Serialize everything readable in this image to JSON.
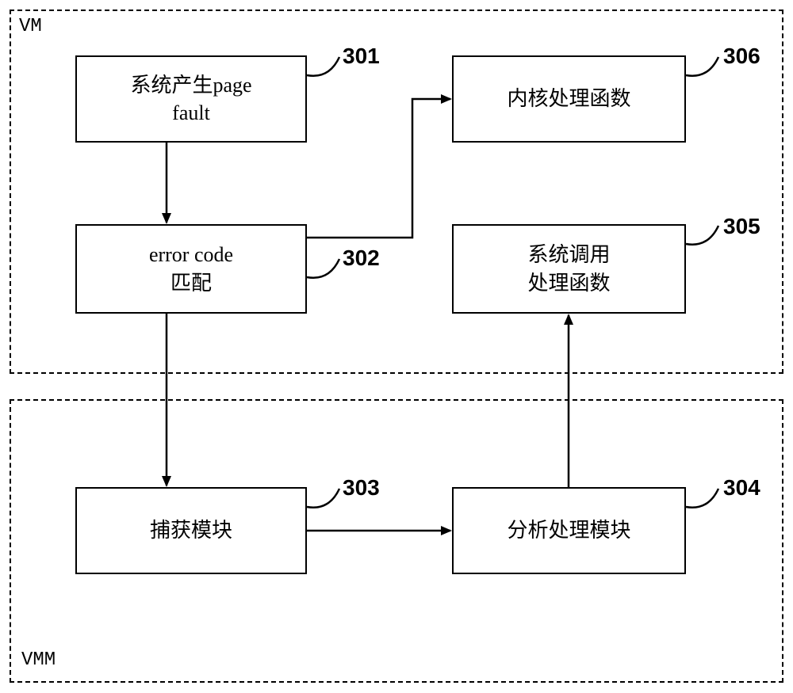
{
  "zones": {
    "vm": {
      "label": "VM"
    },
    "vmm": {
      "label": "VMM"
    }
  },
  "blocks": {
    "b301": {
      "text": "系统产生page\nfault",
      "num": "301"
    },
    "b302": {
      "text": "error code\n匹配",
      "num": "302"
    },
    "b303": {
      "text": "捕获模块",
      "num": "303"
    },
    "b304": {
      "text": "分析处理模块",
      "num": "304"
    },
    "b305": {
      "text": "系统调用\n处理函数",
      "num": "305"
    },
    "b306": {
      "text": "内核处理函数",
      "num": "306"
    }
  }
}
